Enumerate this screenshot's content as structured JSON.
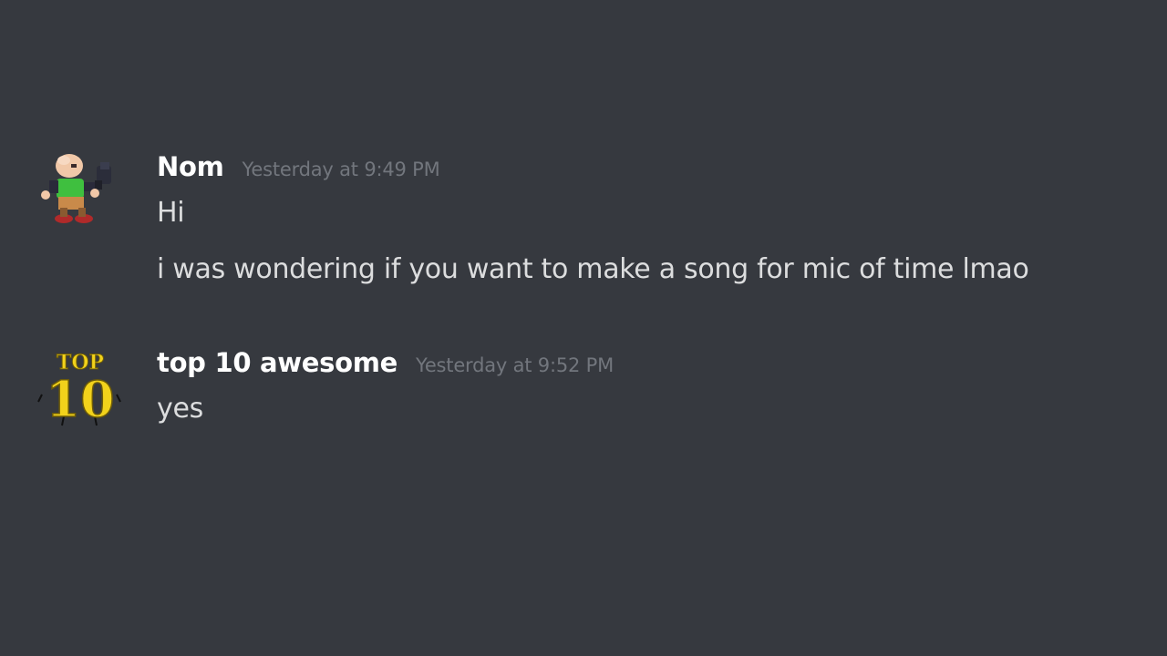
{
  "messages": [
    {
      "username": "Nom",
      "timestamp": "Yesterday at 9:49 PM",
      "avatar_icon": "pixel-character-avatar-icon",
      "lines": [
        "Hi",
        "i was wondering if you want to make a song for mic of time lmao"
      ]
    },
    {
      "username": "top 10 awesome",
      "timestamp": "Yesterday at 9:52 PM",
      "avatar_icon": "top-10-logo-avatar-icon",
      "avatar_logo_text": [
        "TOP",
        "10"
      ],
      "lines": [
        "yes"
      ]
    }
  ],
  "colors": {
    "background": "#36393f",
    "username": "#ffffff",
    "timestamp": "#72767d",
    "message_text": "#dcddde",
    "logo_yellow": "#f2d21b"
  }
}
